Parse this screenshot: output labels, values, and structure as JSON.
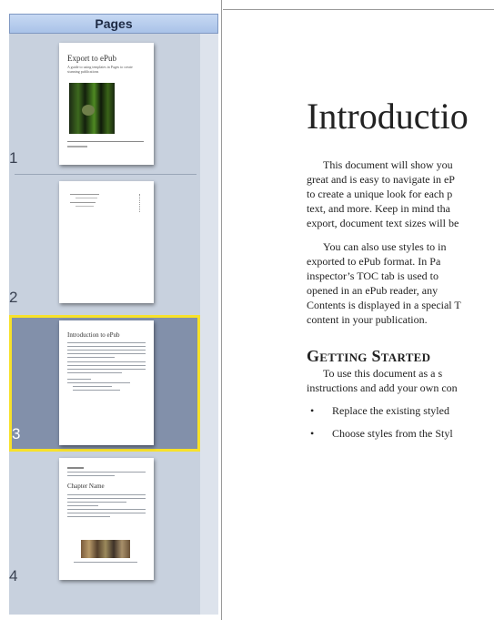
{
  "sidebar": {
    "header": "Pages",
    "pages": [
      {
        "number": "1",
        "thumb_title": "Export to ePub",
        "thumb_subtitle": "A guide to using templates in Pages to create stunning publications"
      },
      {
        "number": "2"
      },
      {
        "number": "3",
        "thumb_title": "Introduction to ePub"
      },
      {
        "number": "4",
        "thumb_title": "Chapter Name"
      }
    ],
    "selected_page": "3"
  },
  "document": {
    "title": "Introductio",
    "paragraph1": [
      "This document will show you",
      "great and is easy to navigate in eP",
      "to create a unique look for each p",
      "text, and more. Keep in mind tha",
      "export, document text sizes will be"
    ],
    "paragraph2": [
      "You can also use styles to in",
      "exported to ePub format. In Pa",
      "inspector’s TOC tab is used to",
      "opened in an ePub reader, any",
      "Contents is displayed in a special T",
      "content in your publication."
    ],
    "heading": "Getting Started",
    "paragraph3": [
      "To use this document as a s",
      "instructions and add your own con"
    ],
    "bullets": [
      "Replace the existing styled",
      "Choose styles from the Styl"
    ]
  },
  "colors": {
    "selection_border": "#f7e12a",
    "selection_fill": "#8290aa",
    "sidebar_bg": "#c8d1de"
  }
}
